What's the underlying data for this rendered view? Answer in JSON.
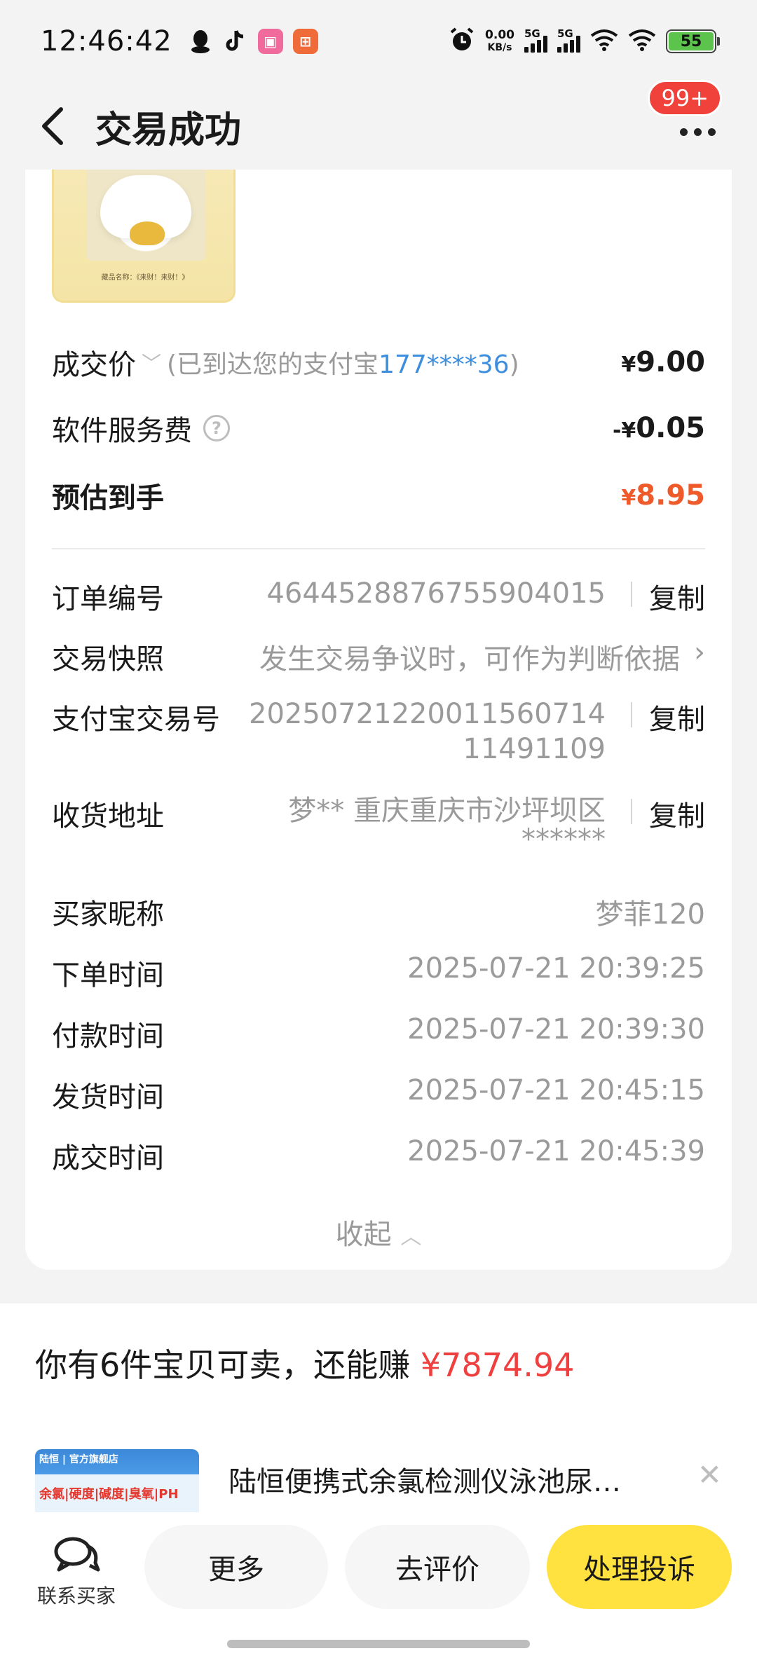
{
  "status_bar": {
    "time": "12:46:42",
    "net_speed_value": "0.00",
    "net_speed_unit": "KB/s",
    "signal_label_1": "5G",
    "signal_label_2": "5G",
    "battery": "55",
    "battery_level": 0.55
  },
  "header": {
    "title": "交易成功",
    "badge": "99+"
  },
  "amounts": {
    "deal_price_label": "成交价",
    "deal_price_note_prefix": "(已到达您的支付宝",
    "deal_price_note_account": "177****36",
    "deal_price_note_suffix": ")",
    "deal_price_symbol": "¥",
    "deal_price_value": "9.00",
    "service_fee_label": "软件服务费",
    "service_fee_symbol": "-¥",
    "service_fee_value": "0.05",
    "estimated_label": "预估到手",
    "estimated_symbol": "¥",
    "estimated_value": "8.95"
  },
  "order_info": {
    "order_no_label": "订单编号",
    "order_no_value": "4644528876755904015",
    "copy_label": "复制",
    "snapshot_label": "交易快照",
    "snapshot_value": "发生交易争议时，可作为判断依据",
    "alipay_no_label": "支付宝交易号",
    "alipay_no_line1": "2025072122001156071‍4",
    "alipay_no_line2": "11491109",
    "address_label": "收货地址",
    "address_line1": "梦** 重庆重庆市沙坪坝区",
    "address_line2": "******",
    "buyer_label": "买家昵称",
    "buyer_value": "梦菲120",
    "order_time_label": "下单时间",
    "order_time_value": "2025-07-21 20:39:25",
    "pay_time_label": "付款时间",
    "pay_time_value": "2025-07-21 20:39:30",
    "ship_time_label": "发货时间",
    "ship_time_value": "2025-07-21 20:45:15",
    "deal_time_label": "成交时间",
    "deal_time_value": "2025-07-21 20:45:39",
    "collapse_label": "收起"
  },
  "product_image": {
    "caption": "藏品名称：《来财！来财！》"
  },
  "sell": {
    "prefix": "你有6件宝贝可卖，还能赚",
    "amount": "¥7874.94"
  },
  "recommendation": {
    "title": "陆恒便携式余氯检测仪泳池尿…",
    "brand": "陆恒 | 官方旗舰店",
    "tags": "余氯|硬度|碱度|臭氧|PH"
  },
  "bottom_bar": {
    "contact_label": "联系买家",
    "more_label": "更多",
    "review_label": "去评价",
    "complaint_label": "处理投诉"
  },
  "colors": {
    "accent_yellow": "#ffe23f",
    "price_orange": "#ef5a2a",
    "earn_red": "#ef3f3f",
    "link_blue": "#3e8ede",
    "badge_red": "#f0413b"
  }
}
